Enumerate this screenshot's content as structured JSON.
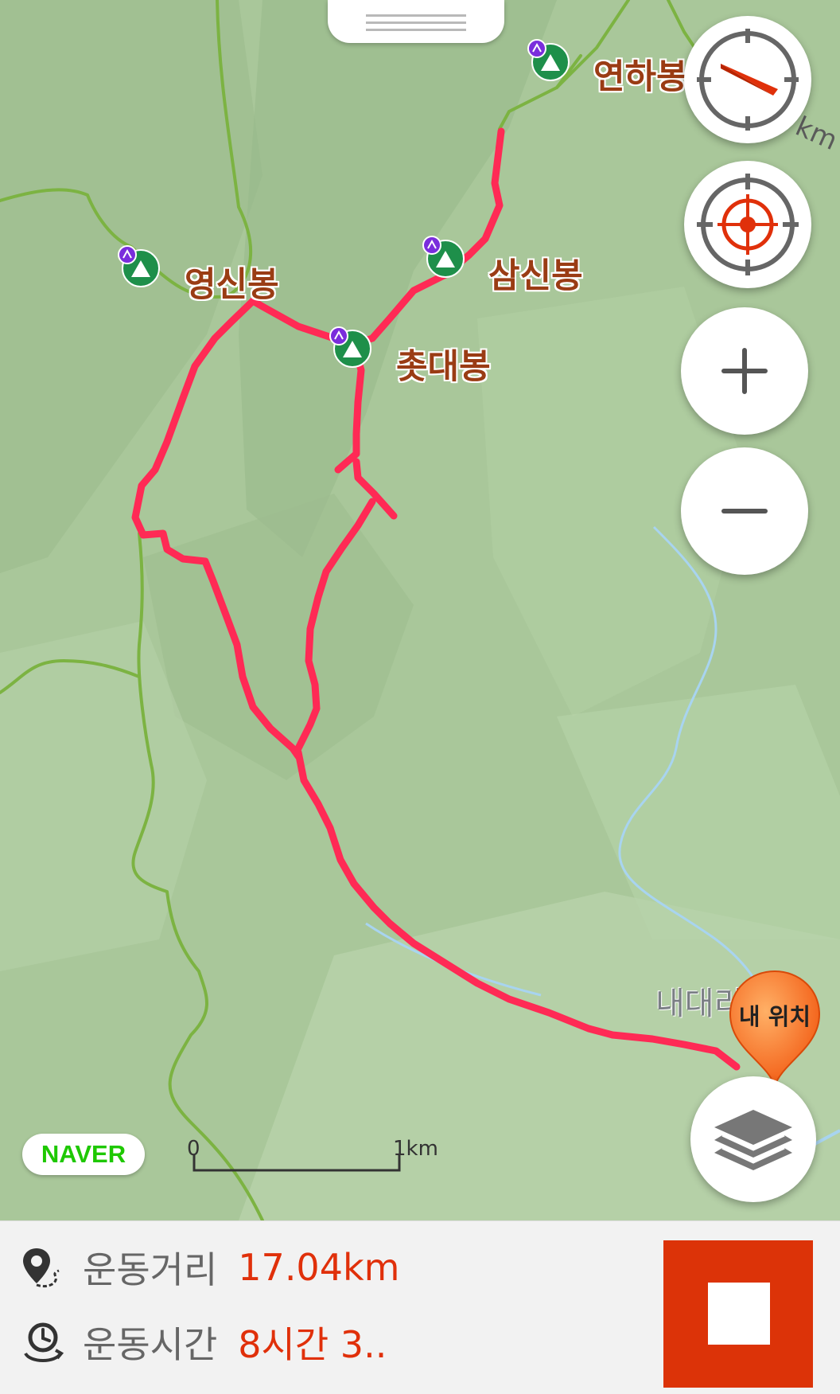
{
  "map": {
    "peaks": [
      {
        "name": "연하봉"
      },
      {
        "name": "영신봉"
      },
      {
        "name": "삼신봉"
      },
      {
        "name": "촛대봉"
      }
    ],
    "village": "내대리",
    "edge_label": "km",
    "scale": {
      "start": "0",
      "end": "1km"
    },
    "provider": "NAVER",
    "my_location": "내 위치"
  },
  "controls": {
    "icons": [
      "compass-icon",
      "current-location-icon",
      "zoom-in-icon",
      "zoom-out-icon",
      "layers-icon"
    ]
  },
  "stats": {
    "distance_label": "운동거리",
    "distance_value": "17.04km",
    "time_label": "운동시간",
    "time_value": "8시간 3.."
  },
  "colors": {
    "route": "#ff2a55",
    "trail": "#7cb342",
    "stream": "#a8d4f0",
    "accent": "#dc3308",
    "value_text": "#e0300a"
  }
}
